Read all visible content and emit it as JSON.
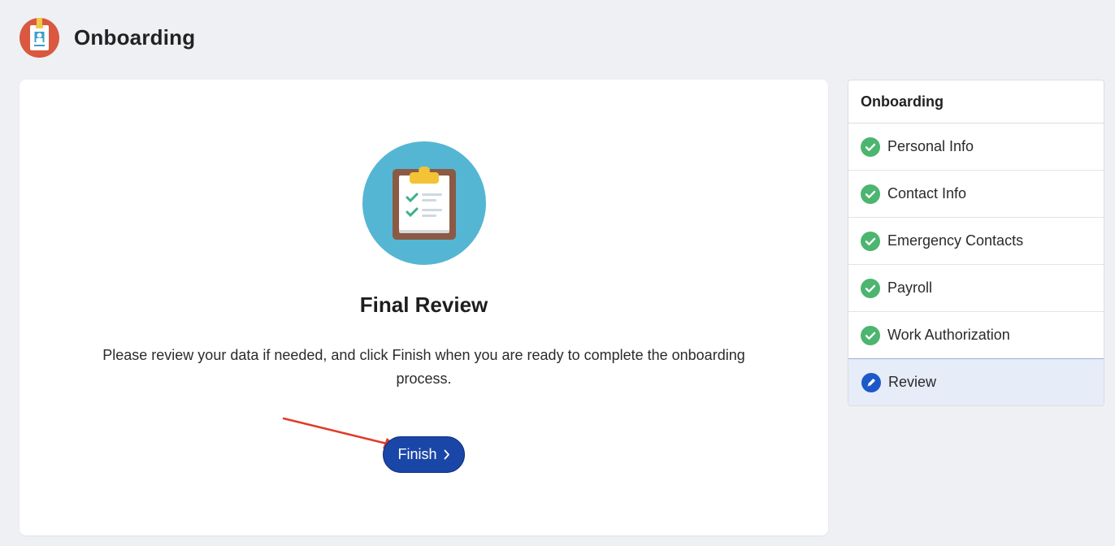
{
  "header": {
    "title": "Onboarding",
    "logo_icon": "id-badge-icon"
  },
  "card": {
    "hero_icon": "clipboard-checklist-icon",
    "title": "Final Review",
    "description": "Please review your data if needed, and click Finish when you are ready to complete the onboarding process.",
    "finish_label": "Finish",
    "finish_icon": "chevron-right-icon"
  },
  "steps": {
    "header": "Onboarding",
    "items": [
      {
        "label": "Personal Info",
        "status": "complete"
      },
      {
        "label": "Contact Info",
        "status": "complete"
      },
      {
        "label": "Emergency Contacts",
        "status": "complete"
      },
      {
        "label": "Payroll",
        "status": "complete"
      },
      {
        "label": "Work Authorization",
        "status": "complete"
      },
      {
        "label": "Review",
        "status": "active"
      }
    ]
  },
  "colors": {
    "page_bg": "#eff0f4",
    "primary_button": "#1a46a8",
    "complete_green": "#4cb56f",
    "active_blue": "#1d58c9",
    "active_row_bg": "#e6ecf8",
    "hero_circle": "#54b6d3",
    "annotation_arrow": "#e03c28"
  }
}
